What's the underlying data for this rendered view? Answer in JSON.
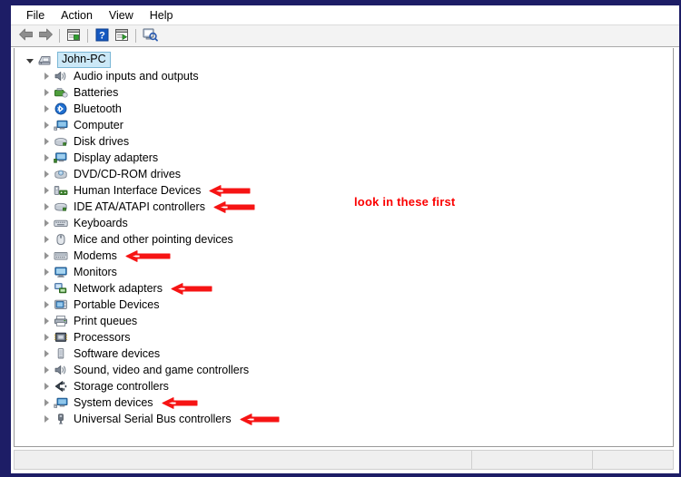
{
  "window": {
    "frame_color": "#1d1d66",
    "background_color": "#2f6f8a"
  },
  "menubar": {
    "items": [
      {
        "label": "File",
        "name": "menu-file"
      },
      {
        "label": "Action",
        "name": "menu-action"
      },
      {
        "label": "View",
        "name": "menu-view"
      },
      {
        "label": "Help",
        "name": "menu-help"
      }
    ]
  },
  "toolbar": {
    "buttons": [
      {
        "icon": "back-arrow-icon",
        "name": "toolbar-back-button"
      },
      {
        "icon": "forward-arrow-icon",
        "name": "toolbar-forward-button"
      },
      {
        "icon": "properties-window-icon",
        "name": "toolbar-properties-button"
      },
      {
        "icon": "help-question-icon",
        "name": "toolbar-help-button"
      },
      {
        "icon": "show-hidden-window-icon",
        "name": "toolbar-show-hidden-button"
      },
      {
        "icon": "scan-hardware-changes-icon",
        "name": "toolbar-scan-button"
      }
    ]
  },
  "tree": {
    "root": {
      "label": "John-PC",
      "icon": "computer-tower-icon",
      "expanded": true,
      "selected": true
    },
    "items": [
      {
        "label": "Audio inputs and outputs",
        "icon": "speaker-icon",
        "arrow": false
      },
      {
        "label": "Batteries",
        "icon": "battery-icon",
        "arrow": false
      },
      {
        "label": "Bluetooth",
        "icon": "bluetooth-icon",
        "arrow": false
      },
      {
        "label": "Computer",
        "icon": "monitor-icon",
        "arrow": false
      },
      {
        "label": "Disk drives",
        "icon": "disk-drive-icon",
        "arrow": false
      },
      {
        "label": "Display adapters",
        "icon": "display-adapter-icon",
        "arrow": false
      },
      {
        "label": "DVD/CD-ROM drives",
        "icon": "dvd-drive-icon",
        "arrow": false
      },
      {
        "label": "Human Interface Devices",
        "icon": "hid-icon",
        "arrow": true,
        "arrow_width": 46
      },
      {
        "label": "IDE ATA/ATAPI controllers",
        "icon": "ide-controller-icon",
        "arrow": true,
        "arrow_width": 46
      },
      {
        "label": "Keyboards",
        "icon": "keyboard-icon",
        "arrow": false
      },
      {
        "label": "Mice and other pointing devices",
        "icon": "mouse-icon",
        "arrow": false
      },
      {
        "label": "Modems",
        "icon": "modem-icon",
        "arrow": true,
        "arrow_width": 50
      },
      {
        "label": "Monitors",
        "icon": "monitor-screen-icon",
        "arrow": false
      },
      {
        "label": "Network adapters",
        "icon": "network-adapter-icon",
        "arrow": true,
        "arrow_width": 46
      },
      {
        "label": "Portable Devices",
        "icon": "portable-device-icon",
        "arrow": false
      },
      {
        "label": "Print queues",
        "icon": "printer-icon",
        "arrow": false
      },
      {
        "label": "Processors",
        "icon": "processor-icon",
        "arrow": false
      },
      {
        "label": "Software devices",
        "icon": "software-device-icon",
        "arrow": false
      },
      {
        "label": "Sound, video and game controllers",
        "icon": "sound-controller-icon",
        "arrow": false
      },
      {
        "label": "Storage controllers",
        "icon": "storage-controller-icon",
        "arrow": false
      },
      {
        "label": "System devices",
        "icon": "system-device-icon",
        "arrow": true,
        "arrow_width": 40
      },
      {
        "label": "Universal Serial Bus controllers",
        "icon": "usb-icon",
        "arrow": true,
        "arrow_width": 44
      }
    ]
  },
  "annotation": {
    "text": "look in these first",
    "color": "#fb0000",
    "arrow_color": "#f61414"
  },
  "statusbar": {
    "segments": [
      "",
      "",
      ""
    ]
  }
}
